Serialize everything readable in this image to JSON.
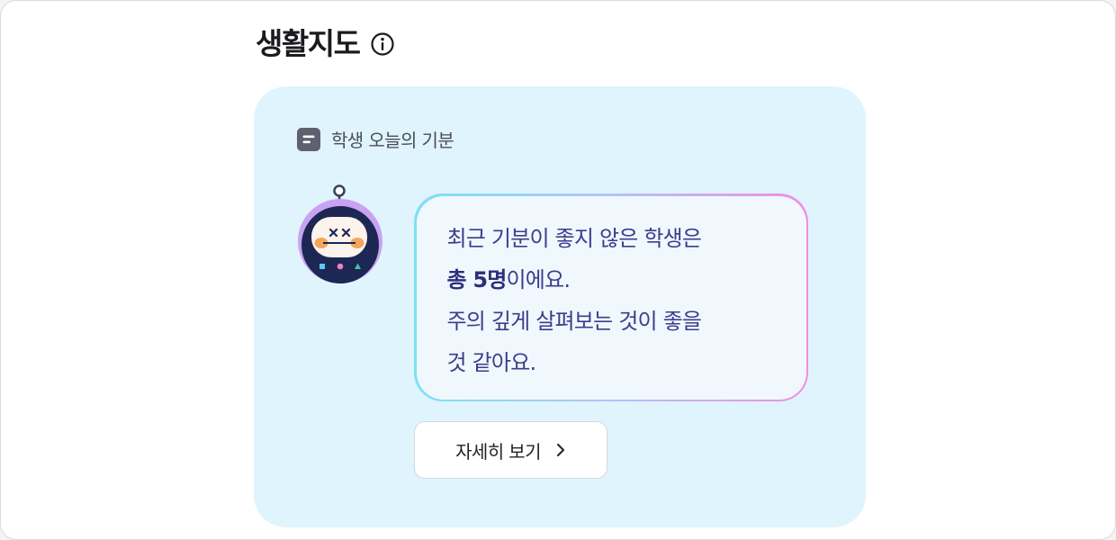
{
  "header": {
    "title": "생활지도",
    "info_icon": "info-circle-icon"
  },
  "mood_card": {
    "background_color": "#e0f4fd",
    "section_label": "학생 오늘의 기분",
    "section_icon": "list-box-icon",
    "avatar_icon": "robot-dizzy-face-icon",
    "message": {
      "line1": "최근 기분이 좋지 않은 학생은",
      "emphasis": "총 5명",
      "line2_suffix": "이에요.",
      "line3": "주의 깊게 살펴보는 것이 좋을",
      "line4": "것 같아요."
    },
    "bubble_gradient": [
      "#7de1f2",
      "#b3c3f7",
      "#f28ce3"
    ],
    "more_button": {
      "label": "자세히 보기",
      "icon": "chevron-right-icon"
    }
  }
}
